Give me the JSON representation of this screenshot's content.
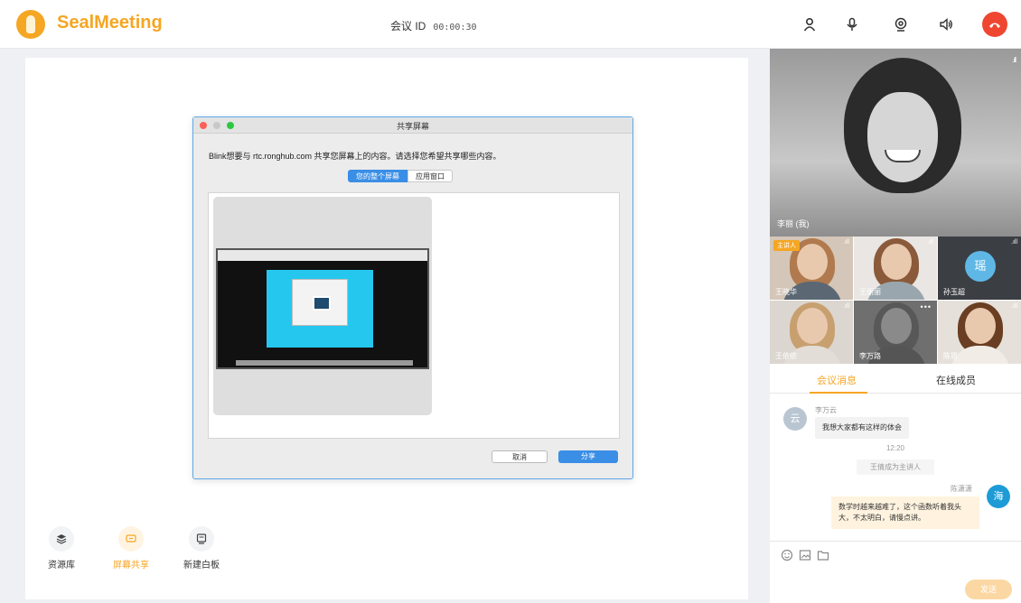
{
  "header": {
    "brand": "SealMeeting",
    "meeting_id_label": "会议 ID",
    "meeting_id_value": "00:00:30"
  },
  "share_dialog": {
    "title": "共享屏幕",
    "description": "Blink想要与 rtc.ronghub.com 共享您屏幕上的内容。请选择您希望共享哪些内容。",
    "tabs": [
      "您的整个屏幕",
      "应用窗口"
    ],
    "cancel_label": "取消",
    "share_label": "分享"
  },
  "toolbar": [
    {
      "label": "资源库",
      "icon": "library-icon"
    },
    {
      "label": "屏幕共享",
      "icon": "screen-share-icon"
    },
    {
      "label": "新建白板",
      "icon": "whiteboard-icon"
    }
  ],
  "videos": {
    "main_name": "李丽 (我)",
    "host_badge": "主讲人",
    "tiles": [
      {
        "name": "王晓华"
      },
      {
        "name": "王丽丽"
      },
      {
        "name": "孙玉超",
        "avatar_char": "瑶"
      },
      {
        "name": "王依依"
      },
      {
        "name": "李万路"
      },
      {
        "name": "陈思"
      }
    ]
  },
  "side_tabs": {
    "messages": "会议消息",
    "members": "在线成员"
  },
  "messages": {
    "m1_name": "李万云",
    "m1_avatar": "云",
    "m1_text": "我想大家都有这样的体会",
    "time": "12:20",
    "system_note": "王倩成为主讲人",
    "m2_name": "陈潇潇",
    "m2_avatar": "海",
    "m2_text": "数学时越来越难了，这个函数听着我头大，不太明白，请慢点讲。"
  },
  "input": {
    "send_label": "发送"
  },
  "colors": {
    "accent": "#f5a623",
    "hangup": "#ef4631",
    "primary_blue": "#3a8ee6"
  }
}
